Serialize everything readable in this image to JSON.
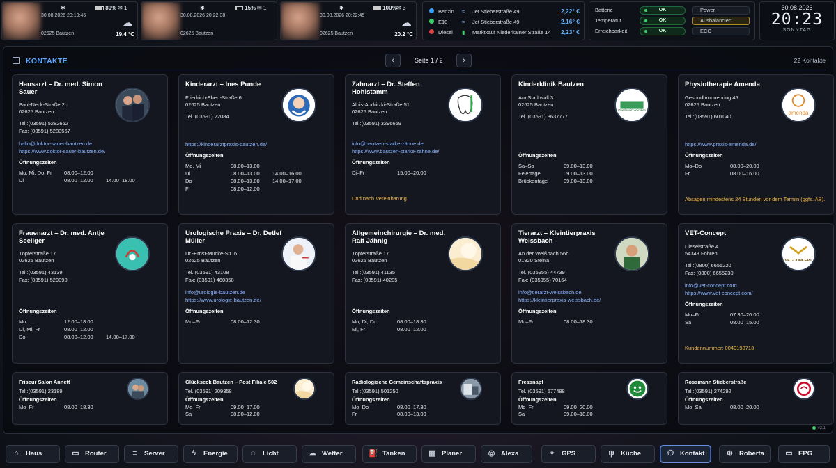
{
  "weather_cards": [
    {
      "timestamp": "30.08.2026 20:19:46",
      "location": "02625 Bautzen",
      "temperature": "19.4 °C",
      "battery": "80%",
      "mail": "1",
      "weather_icon": "cloud-icon"
    },
    {
      "timestamp": "30.08.2026 20:22:38",
      "location": "02625 Bautzen",
      "temperature": "",
      "battery": "15%",
      "mail": "1",
      "weather_icon": ""
    },
    {
      "timestamp": "30.08.2026 20:22:45",
      "location": "02625 Bautzen",
      "temperature": "20.2 °C",
      "battery": "100%",
      "mail": "3",
      "weather_icon": "cloud-icon"
    }
  ],
  "fuel": [
    {
      "type": "Benzin",
      "station": "Jet Stieberstraße 49",
      "price": "2,22° €",
      "dot": "#3aa0ff"
    },
    {
      "type": "E10",
      "station": "Jet Stieberstraße 49",
      "price": "2,16° €",
      "dot": "#3ad06a"
    },
    {
      "type": "Diesel",
      "station": "Marktkauf Niederkainer Straße 14",
      "price": "2,23° €",
      "dot": "#e04040"
    }
  ],
  "status": [
    {
      "label": "Batterie",
      "value": "OK",
      "mode": "Power"
    },
    {
      "label": "Temperatur",
      "value": "OK",
      "mode": "Ausbalanciert"
    },
    {
      "label": "Erreichbarkeit",
      "value": "OK",
      "mode": "ECO"
    }
  ],
  "clock": {
    "date": "30.08.2026",
    "time": "20:23",
    "weekday": "SONNTAG"
  },
  "panel": {
    "title": "KONTAKTE",
    "page": "Seite 1 / 2",
    "count": "22 Kontakte",
    "prev": "‹",
    "next": "›",
    "version": "v2.1"
  },
  "contacts": [
    {
      "name": "Hausarzt – Dr. med. Simon Sauer",
      "street": "Paul-Neck-Straße 2c",
      "city": "02625 Bautzen",
      "tel": "Tel.:(03591) 5282662",
      "fax": "Fax: (03591) 5283567",
      "email": "hallo@doktor-sauer-bautzen.de",
      "web": "https://www.doktor-sauer-bautzen.de/",
      "hours_label": "Öffnungszeiten",
      "hours": [
        [
          "Mo, Mi, Do, Fr",
          "08.00–12.00",
          ""
        ],
        [
          "Di",
          "08.00–12.00",
          "14.00–18.00"
        ]
      ],
      "note": ""
    },
    {
      "name": "Kinderarzt – Ines Punde",
      "street": "Friedrich-Ebert-Straße 6",
      "city": "02625 Bautzen",
      "tel": "Tel.:(03591) 22084",
      "fax": "",
      "email": "",
      "web": "https://kinderarztpraxis-bautzen.de/",
      "hours_label": "Öffnungszeiten",
      "hours": [
        [
          "Mo, Mi",
          "08.00–13.00",
          ""
        ],
        [
          "Di",
          "08.00–13.00",
          "14.00–16.00"
        ],
        [
          "Do",
          "08.00–13.00",
          "14.00–17.00"
        ],
        [
          "Fr",
          "08.00–12.00",
          ""
        ]
      ],
      "note": ""
    },
    {
      "name": "Zahnarzt – Dr. Steffen Hohlstamm",
      "street": "Alois-Andritzki-Straße 51",
      "city": "02625 Bautzen",
      "tel": "Tel.:(03591) 3296669",
      "fax": "",
      "email": "info@bautzen-starke-zähne.de",
      "web": "https://www.bautzen-starke-zähne.de/",
      "hours_label": "Öffnungszeiten",
      "hours": [
        [
          "Di–Fr",
          "15.00–20.00",
          ""
        ]
      ],
      "note": "Und nach Vereinbarung."
    },
    {
      "name": "Kinderklinik Bautzen",
      "street": "Am Stadtwall 3",
      "city": "02625 Bautzen",
      "tel": "Tel.:(03591) 3637777",
      "fax": "",
      "email": "",
      "web": "",
      "hours_label": "Öffnungszeiten",
      "hours": [
        [
          "Sa–So",
          "09.00–13.00",
          ""
        ],
        [
          "Feiertage",
          "09.00–13.00",
          ""
        ],
        [
          "Brückentage",
          "09.00–13.00",
          ""
        ]
      ],
      "note": ""
    },
    {
      "name": "Physiotherapie Amenda",
      "street": "Gesundbrunnenring 45",
      "city": "02625 Bautzen",
      "tel": "Tel.:(03591) 601040",
      "fax": "",
      "email": "",
      "web": "https://www.praxis-amenda.de/",
      "hours_label": "Öffnungszeiten",
      "hours": [
        [
          "Mo–Do",
          "08.00–20.00",
          ""
        ],
        [
          "Fr",
          "08.00–16.00",
          ""
        ]
      ],
      "note": "Absagen mindestens 24 Stunden vor dem Termin (ggfs. AB)."
    },
    {
      "name": "Frauenarzt – Dr. med. Antje Seeliger",
      "street": "Töpferstraße 17",
      "city": "02625 Bautzen",
      "tel": "Tel.:(03591) 43139",
      "fax": "Fax: (03591) 529090",
      "email": "",
      "web": "",
      "hours_label": "Öffnungszeiten",
      "hours": [
        [
          "Mo",
          "12.00–18.00",
          ""
        ],
        [
          "Di, Mi, Fr",
          "08.00–12.00",
          ""
        ],
        [
          "Do",
          "08.00–12.00",
          "14.00–17.00"
        ]
      ],
      "note": ""
    },
    {
      "name": "Urologische Praxis – Dr. Detlef Müller",
      "street": "Dr.-Ernst-Mucke-Str. 6",
      "city": "02625 Bautzen",
      "tel": "Tel.:(03591) 43108",
      "fax": "Fax: (03591) 460358",
      "email": "info@urologie-bautzen.de",
      "web": "https://www.urologie-bautzen.de/",
      "hours_label": "Öffnungszeiten",
      "hours": [
        [
          "Mo–Fr",
          "08.00–12.30",
          ""
        ]
      ],
      "note": ""
    },
    {
      "name": "Allgemeinchirurgie – Dr. med. Ralf Jähnig",
      "street": "Töpferstraße 17",
      "city": "02625 Bautzen",
      "tel": "Tel.:(03591) 41135",
      "fax": "Fax: (03591) 40205",
      "email": "",
      "web": "",
      "hours_label": "Öffnungszeiten",
      "hours": [
        [
          "Mo, Di, Do",
          "08.00–18.30",
          ""
        ],
        [
          "Mi, Fr",
          "08.00–12.00",
          ""
        ]
      ],
      "note": ""
    },
    {
      "name": "Tierarzt – Kleintierpraxis Weissbach",
      "street": "An der Weißbach 56b",
      "city": "01920 Steina",
      "tel": "Tel.:(035955) 44739",
      "fax": "Fax: (035955) 70164",
      "email": "info@tierarzt-weissbach.de",
      "web": "https://kleintierpraxis-weissbach.de/",
      "hours_label": "Öffnungszeiten",
      "hours": [
        [
          "Mo–Fr",
          "08.00–18.30",
          ""
        ]
      ],
      "note": ""
    },
    {
      "name": "VET-Concept",
      "street": "Dieselstraße 4",
      "city": "54343 Föhren",
      "tel": "Tel.:(0800) 6655220",
      "fax": "Fax: (0800) 6655230",
      "email": "info@vet-concept.com",
      "web": "https://www.vet-concept.com/",
      "hours_label": "Öffnungszeiten",
      "hours": [
        [
          "Mo–Fr",
          "07.30–20.00",
          ""
        ],
        [
          "Sa",
          "08.00–15.00",
          ""
        ]
      ],
      "note": "Kundennummer: 0049198713"
    }
  ],
  "logos": {
    "kinderklinik": "Oberlausitz-Kliniken",
    "amenda": "amenda",
    "vet": "VET-CONCEPT"
  },
  "small_contacts": [
    {
      "name": "Friseur Salon Annett",
      "tel": "Tel.:(03591) 23189",
      "hours_label": "Öffnungszeiten",
      "hours": [
        [
          "Mo–Fr",
          "08.00–18.30"
        ]
      ]
    },
    {
      "name": "Glückseck Bautzen – Post Filiale 502",
      "tel": "Tel.:(03591) 209358",
      "hours_label": "Öffnungszeiten",
      "hours": [
        [
          "Mo–Fr",
          "09.00–17.00"
        ],
        [
          "Sa",
          "08.00–12.00"
        ]
      ]
    },
    {
      "name": "Radiologische Gemeinschaftspraxis",
      "tel": "Tel.:(03591) 501250",
      "hours_label": "Öffnungszeiten",
      "hours": [
        [
          "Mo–Do",
          "08.00–17.30"
        ],
        [
          "Fr",
          "08.00–13.00"
        ]
      ]
    },
    {
      "name": "Fressnapf",
      "tel": "Tel.:(03591) 677488",
      "hours_label": "Öffnungszeiten",
      "hours": [
        [
          "Mo–Fr",
          "09.00–20.00"
        ],
        [
          "Sa",
          "09.00–18.00"
        ]
      ]
    },
    {
      "name": "Rossmann Stieberstraße",
      "tel": "Tel.:(03591) 274292",
      "hours_label": "Öffnungszeiten",
      "hours": [
        [
          "Mo–Sa",
          "08.00–20.00"
        ]
      ]
    }
  ],
  "nav": [
    {
      "label": "Haus",
      "icon": "home-icon"
    },
    {
      "label": "Router",
      "icon": "router-icon"
    },
    {
      "label": "Server",
      "icon": "server-icon"
    },
    {
      "label": "Energie",
      "icon": "bolt-icon"
    },
    {
      "label": "Licht",
      "icon": "bulb-icon"
    },
    {
      "label": "Wetter",
      "icon": "cloud-icon"
    },
    {
      "label": "Tanken",
      "icon": "fuel-icon"
    },
    {
      "label": "Planer",
      "icon": "calendar-icon"
    },
    {
      "label": "Alexa",
      "icon": "alexa-icon"
    },
    {
      "label": "GPS",
      "icon": "pin-icon"
    },
    {
      "label": "Küche",
      "icon": "kitchen-icon"
    },
    {
      "label": "Kontakt",
      "icon": "contacts-icon"
    },
    {
      "label": "Roberta",
      "icon": "robot-icon"
    },
    {
      "label": "EPG",
      "icon": "tv-icon"
    }
  ],
  "nav_active": "Kontakt"
}
